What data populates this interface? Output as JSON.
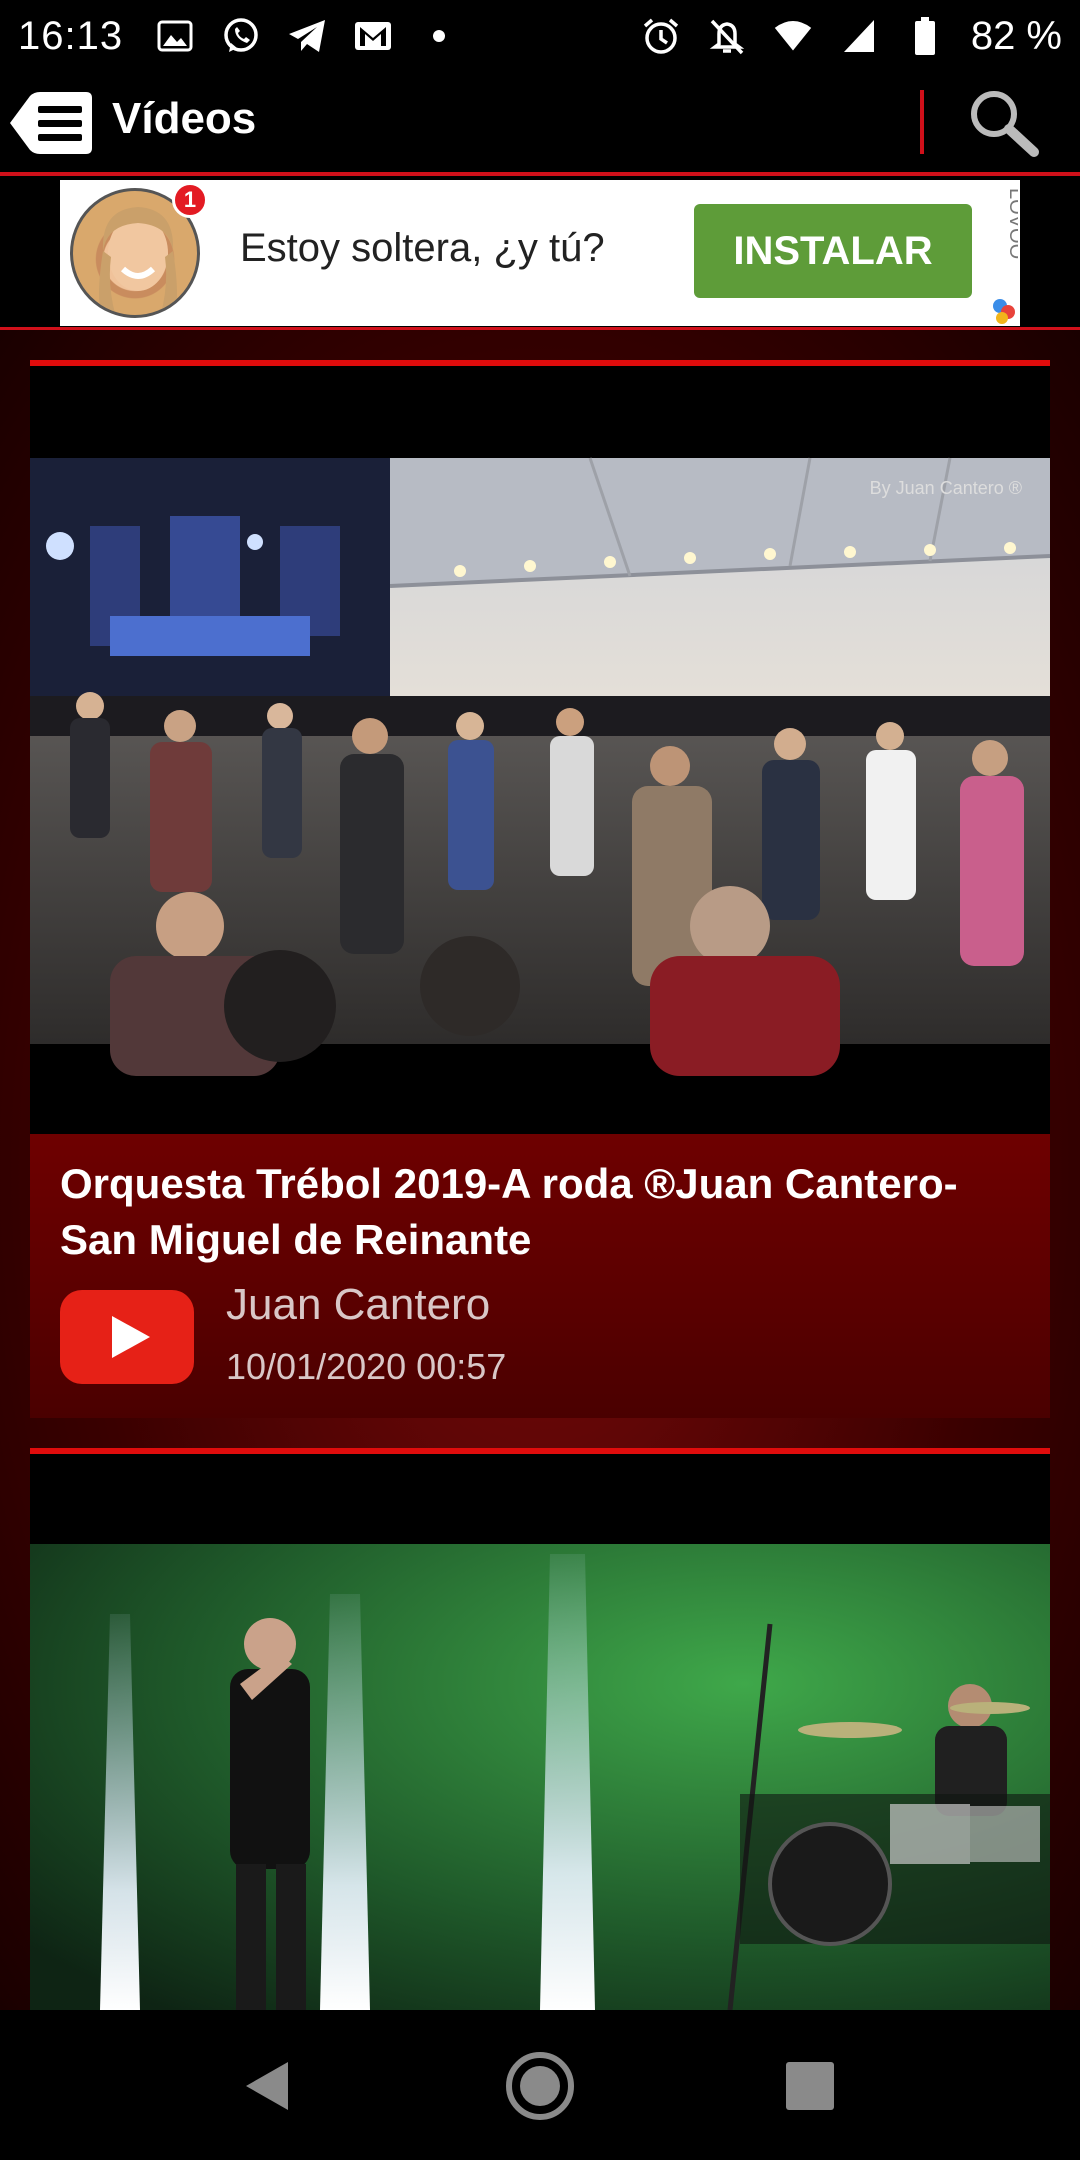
{
  "status_bar": {
    "time": "16:13",
    "battery": "82 %",
    "left_icons": [
      "image-icon",
      "whatsapp-icon",
      "telegram-icon",
      "gmail-icon",
      "dot-icon"
    ],
    "right_icons": [
      "alarm-icon",
      "notifications-off-icon",
      "wifi-icon",
      "signal-icon",
      "battery-icon"
    ]
  },
  "app_bar": {
    "title": "Vídeos"
  },
  "ad": {
    "badge": "1",
    "text": "Estoy soltera, ¿y tú?",
    "button": "INSTALAR",
    "brand": "LOVOO"
  },
  "videos": [
    {
      "watermark": "By Juan Cantero ®",
      "title": "Orquesta Trébol 2019-A roda ®Juan Cantero-San Miguel de Reinante",
      "channel": "Juan Cantero",
      "date": "10/01/2020 00:57"
    },
    {
      "title": "",
      "channel": "",
      "date": ""
    }
  ],
  "colors": {
    "accent": "#e00c0c",
    "card_info": "#6e0000",
    "install_button": "#5e9c39",
    "youtube_red": "#e62117"
  },
  "nav_bar": {
    "buttons": [
      "back-icon",
      "home-icon",
      "recents-icon"
    ]
  }
}
